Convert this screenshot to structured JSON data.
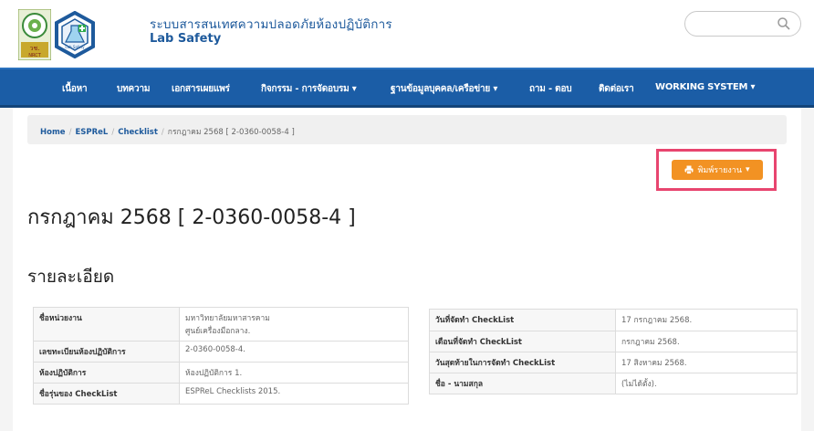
{
  "header": {
    "title_th": "ระบบสารสนเทศความปลอดภัยห้องปฏิบัติการ",
    "title_en": "Lab Safety",
    "logo1_text": "วช.\nNRCT",
    "logo2_text": "Lab Safety"
  },
  "search": {
    "placeholder": ""
  },
  "nav": {
    "items": [
      "เนื้อหา",
      "บทความ",
      "เอกสารเผยแพร่",
      "กิจกรรม - การจัดอบรม ▾",
      "ฐานข้อมูลบุคคล/เครือข่าย ▾",
      "ถาม - ตอบ",
      "ติดต่อเรา",
      "WORKING SYSTEM ▾"
    ]
  },
  "breadcrumb": {
    "items": [
      "Home",
      "ESPReL",
      "Checklist"
    ],
    "current": "กรกฎาคม 2568 [ 2-0360-0058-4 ]"
  },
  "print_button": {
    "label": "พิมพ์รายงาน",
    "caret": "▾"
  },
  "page_title": "กรกฎาคม 2568 [ 2-0360-0058-4 ]",
  "section_title": "รายละเอียด",
  "left_table": [
    {
      "label": "ชื่อหน่วยงาน",
      "value": "มหาวิทยาลัยมหาสารคาม\nศูนย์เครื่องมือกลาง."
    },
    {
      "label": "เลขทะเบียนห้องปฏิบัติการ",
      "value": "2-0360-0058-4."
    },
    {
      "label": "ห้องปฏิบัติการ",
      "value": "ห้องปฏิบัติการ 1."
    },
    {
      "label": "ชื่อรุ่นของ CheckList",
      "value": "ESPReL Checklists 2015."
    }
  ],
  "right_table": [
    {
      "label": "วันที่จัดทำ CheckList",
      "value": "17 กรกฎาคม 2568."
    },
    {
      "label": "เดือนที่จัดทำ CheckList",
      "value": "กรกฎาคม 2568."
    },
    {
      "label": "วันสุดท้ายในการจัดทำ CheckList",
      "value": "17 สิงหาคม 2568."
    },
    {
      "label": "ชื่อ - นามสกุล",
      "value": "(ไม่ได้ตั้ง)."
    }
  ],
  "colors": {
    "nav_bg": "#1b5da6",
    "brand_blue": "#1e5a9c",
    "print_button": "#f29223",
    "highlight": "#e8456f"
  }
}
